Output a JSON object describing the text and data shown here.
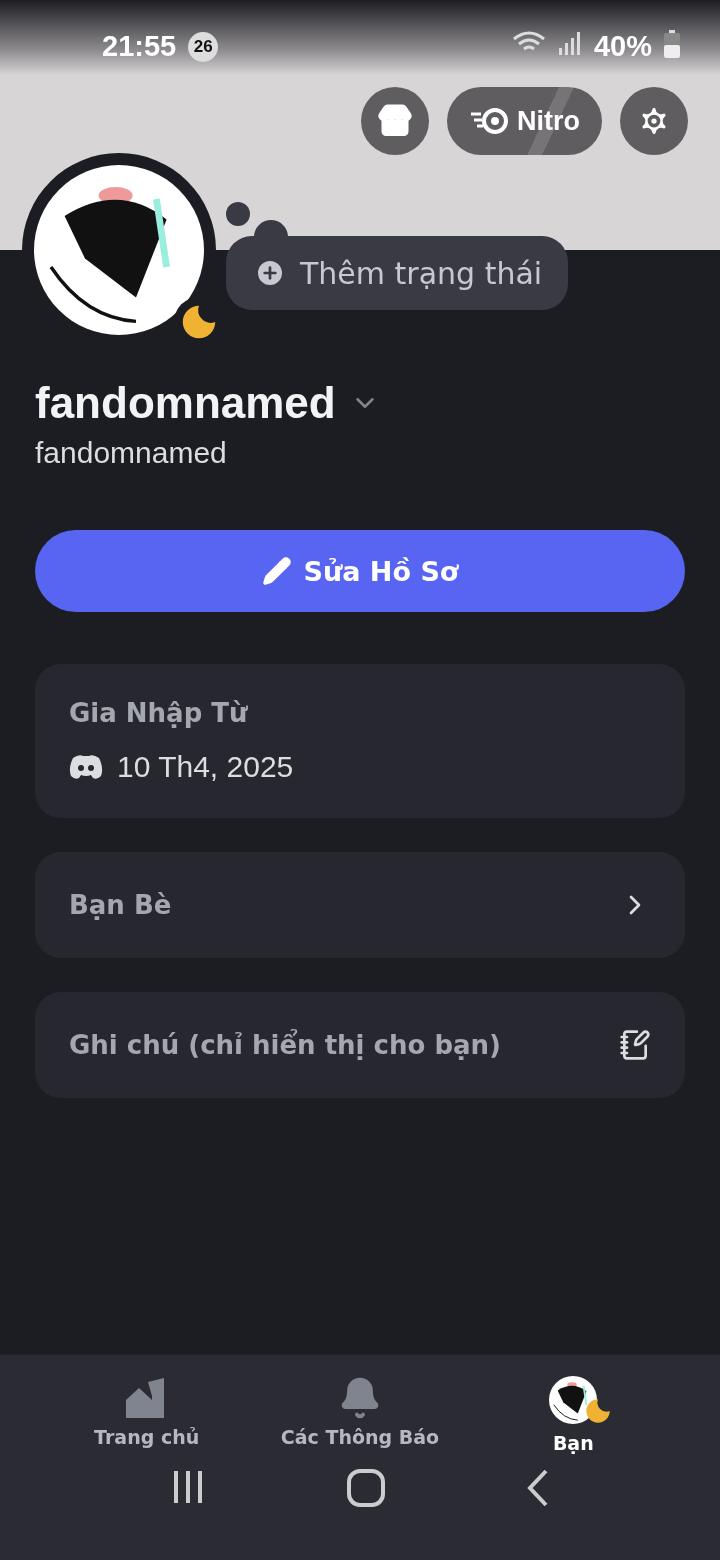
{
  "status_bar": {
    "time": "21:55",
    "notification_count": "26",
    "battery": "40%"
  },
  "header_buttons": [
    {
      "kind": "shop"
    },
    {
      "kind": "nitro",
      "label": "Nitro"
    },
    {
      "kind": "settings"
    }
  ],
  "profile": {
    "idle": true,
    "status_prompt": "Thêm trạng thái",
    "display_name": "fandomnamed",
    "username": "fandomnamed"
  },
  "edit_button": "Sửa Hồ Sơ",
  "cards": [
    {
      "kind": "joined",
      "title": "Gia Nhập Từ",
      "value": "10 Th4, 2025"
    },
    {
      "kind": "link",
      "title": "Bạn Bè"
    },
    {
      "kind": "note",
      "title": "Ghi chú (chỉ hiển thị cho bạn)"
    }
  ],
  "bottom_nav": [
    {
      "kind": "home",
      "label": "Trang chủ",
      "selected": false
    },
    {
      "kind": "bell",
      "label": "Các Thông Báo",
      "selected": false
    },
    {
      "kind": "avatar",
      "label": "Bạn",
      "selected": true
    }
  ]
}
